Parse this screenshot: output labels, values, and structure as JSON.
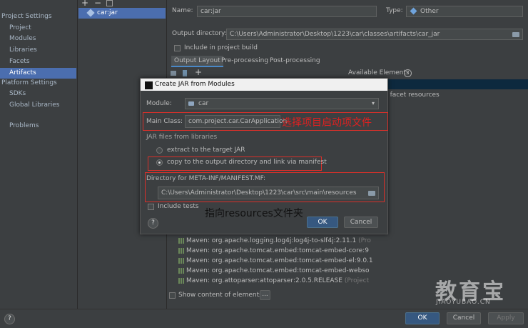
{
  "sidebar": {
    "sections": [
      {
        "label": "Project Settings"
      },
      {
        "label": "Platform Settings"
      }
    ],
    "items": [
      {
        "label": "Project"
      },
      {
        "label": "Modules"
      },
      {
        "label": "Libraries"
      },
      {
        "label": "Facets"
      },
      {
        "label": "Artifacts"
      },
      {
        "label": "SDKs"
      },
      {
        "label": "Global Libraries"
      },
      {
        "label": "Problems"
      }
    ]
  },
  "artifacts": {
    "toolbar": {
      "add": "+",
      "remove": "−"
    },
    "selected": "car:jar"
  },
  "editor": {
    "name_label": "Name:",
    "name_value": "car:jar",
    "type_label": "Type:",
    "type_value": "Other",
    "output_label": "Output directory:",
    "output_value": "C:\\Users\\Administrator\\Desktop\\1223\\car\\classes\\artifacts\\car_jar",
    "include_build_label": "Include in project build",
    "tabs": [
      "Output Layout",
      "Pre-processing",
      "Post-processing"
    ],
    "available_label": "Available Elements",
    "facet_text": "b facet resources",
    "show_content_label": "Show content of elements",
    "more_button": "...",
    "tree_rows": [
      {
        "main": "Maven: org.apache.logging.log4j:log4j-to-slf4j:2.11.1",
        "dim": "(Pro"
      },
      {
        "main": "Maven: org.apache.tomcat.embed:tomcat-embed-core:9",
        "dim": ""
      },
      {
        "main": "Maven: org.apache.tomcat.embed:tomcat-embed-el:9.0.1",
        "dim": ""
      },
      {
        "main": "Maven: org.apache.tomcat.embed:tomcat-embed-webso",
        "dim": ""
      },
      {
        "main": "Maven: org.attoparser:attoparser:2.0.5.RELEASE",
        "dim": "(Project"
      }
    ]
  },
  "dialog": {
    "title": "Create JAR from Modules",
    "module_label": "Module:",
    "module_value": "car",
    "main_class_label": "Main Class:",
    "main_class_value": "com.project.car.CarApplication",
    "jar_files_label": "JAR files from libraries",
    "opt_extract": "extract to the target JAR",
    "opt_copy": "copy to the output directory and link via manifest",
    "manifest_label": "Directory for META-INF/MANIFEST.MF:",
    "manifest_value": "C:\\Users\\Administrator\\Desktop\\1223\\car\\src\\main\\resources",
    "include_tests_label": "Include tests",
    "ok": "OK",
    "cancel": "Cancel",
    "help": "?"
  },
  "annotations": {
    "main_class_note": "选择项目启动项文件",
    "resources_note": "指向resources文件夹"
  },
  "bottom": {
    "help": "?",
    "ok": "OK",
    "cancel": "Cancel",
    "apply": "Apply"
  },
  "watermark": {
    "cn": "教育宝",
    "url": "JIAOYUBAO.CN"
  },
  "colors": {
    "background": "#3c3f41",
    "selection": "#4b6eaf",
    "primary_button": "#365880",
    "annotation": "#e02020"
  }
}
